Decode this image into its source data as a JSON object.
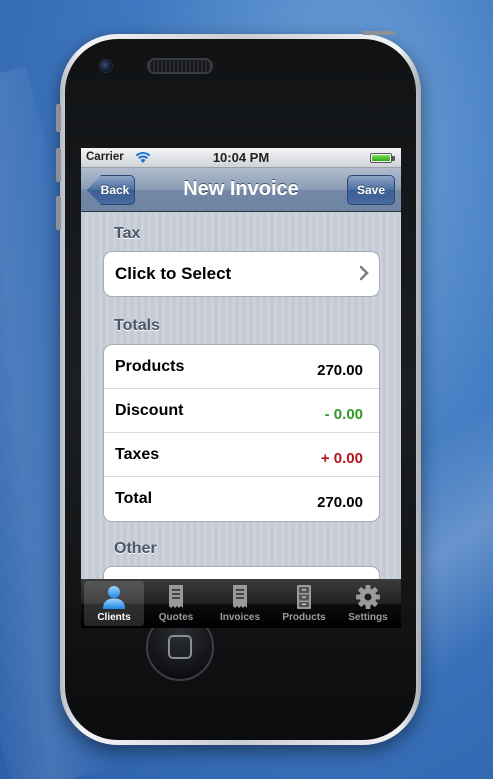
{
  "status_bar": {
    "carrier": "Carrier",
    "time": "10:04 PM"
  },
  "nav": {
    "back_label": "Back",
    "title": "New Invoice",
    "save_label": "Save"
  },
  "tax_section": {
    "header": "Tax",
    "select_label": "Click to Select"
  },
  "totals_section": {
    "header": "Totals",
    "rows": [
      {
        "label": "Products",
        "value": "270.00",
        "color": "#000000"
      },
      {
        "label": "Discount",
        "value": "- 0.00",
        "color": "#2e9a2a"
      },
      {
        "label": "Taxes",
        "value": "+ 0.00",
        "color": "#b3141c"
      },
      {
        "label": "Total",
        "value": "270.00",
        "color": "#000000"
      }
    ]
  },
  "other_section": {
    "header": "Other"
  },
  "tabbar": {
    "tabs": [
      {
        "label": "Clients",
        "icon": "person-icon",
        "active": true
      },
      {
        "label": "Quotes",
        "icon": "receipt-icon",
        "active": false
      },
      {
        "label": "Invoices",
        "icon": "receipt-icon",
        "active": false
      },
      {
        "label": "Products",
        "icon": "cabinet-icon",
        "active": false
      },
      {
        "label": "Settings",
        "icon": "gear-icon",
        "active": false
      }
    ]
  }
}
